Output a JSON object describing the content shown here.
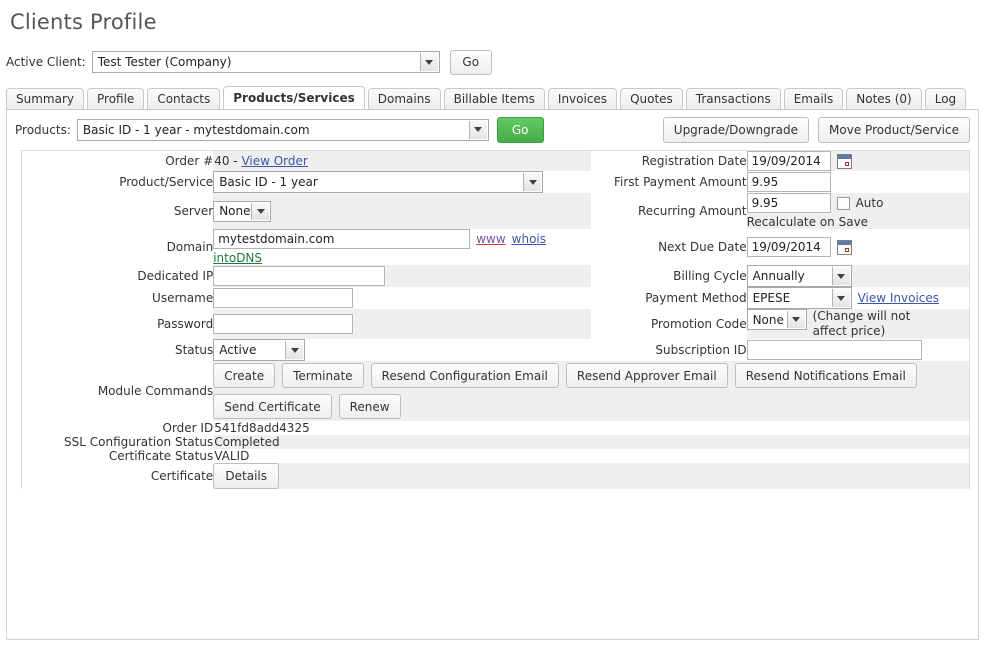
{
  "header": {
    "page_title": "Clients Profile",
    "active_client_label": "Active Client:",
    "active_client_value": "Test Tester (Company)",
    "go_label": "Go"
  },
  "tabs": [
    {
      "label": "Summary",
      "active": false
    },
    {
      "label": "Profile",
      "active": false
    },
    {
      "label": "Contacts",
      "active": false
    },
    {
      "label": "Products/Services",
      "active": true
    },
    {
      "label": "Domains",
      "active": false
    },
    {
      "label": "Billable Items",
      "active": false
    },
    {
      "label": "Invoices",
      "active": false
    },
    {
      "label": "Quotes",
      "active": false
    },
    {
      "label": "Transactions",
      "active": false
    },
    {
      "label": "Emails",
      "active": false
    },
    {
      "label": "Notes (0)",
      "active": false
    },
    {
      "label": "Log",
      "active": false
    }
  ],
  "toolbar": {
    "products_label": "Products:",
    "products_value": "Basic ID - 1 year - mytestdomain.com",
    "go_label": "Go",
    "upgrade_label": "Upgrade/Downgrade",
    "move_label": "Move Product/Service"
  },
  "left_fields": {
    "order_label": "Order #",
    "order_value": "40 - ",
    "order_link": "View Order",
    "product_label": "Product/Service",
    "product_value": "Basic ID - 1 year",
    "server_label": "Server",
    "server_value": "None",
    "domain_label": "Domain",
    "domain_value": "mytestdomain.com",
    "domain_link_www": "www",
    "domain_link_whois": "whois",
    "domain_link_intodns": "intoDNS",
    "dedicated_ip_label": "Dedicated IP",
    "dedicated_ip_value": "",
    "username_label": "Username",
    "username_value": "",
    "password_label": "Password",
    "password_value": "",
    "status_label": "Status",
    "status_value": "Active"
  },
  "right_fields": {
    "registration_date_label": "Registration Date",
    "registration_date_value": "19/09/2014",
    "first_payment_label": "First Payment Amount",
    "first_payment_value": "9.95",
    "recurring_label": "Recurring Amount",
    "recurring_value": "9.95",
    "auto_label": "Auto",
    "recalculate_label": "Recalculate on Save",
    "next_due_label": "Next Due Date",
    "next_due_value": "19/09/2014",
    "billing_cycle_label": "Billing Cycle",
    "billing_cycle_value": "Annually",
    "payment_method_label": "Payment Method",
    "payment_method_value": "EPESE",
    "view_invoices_link": "View Invoices",
    "promotion_code_label": "Promotion Code",
    "promotion_code_value": "None",
    "promotion_note": "(Change will not affect price)",
    "subscription_id_label": "Subscription ID",
    "subscription_id_value": ""
  },
  "module_commands": {
    "label": "Module Commands",
    "buttons": [
      "Create",
      "Terminate",
      "Resend Configuration Email",
      "Resend Approver Email",
      "Resend Notifications Email",
      "Send Certificate",
      "Renew"
    ]
  },
  "ssl_fields": {
    "order_id_label": "Order ID",
    "order_id_value": "541fd8add4325",
    "ssl_config_label": "SSL Configuration Status",
    "ssl_config_value": "Completed",
    "cert_status_label": "Certificate Status",
    "cert_status_value": "VALID",
    "certificate_label": "Certificate",
    "certificate_button": "Details"
  },
  "colors": {
    "accent_green": "#45ad45",
    "link_blue": "#3a57a8",
    "link_green": "#1f7a3f",
    "row_grey": "#efefef"
  }
}
